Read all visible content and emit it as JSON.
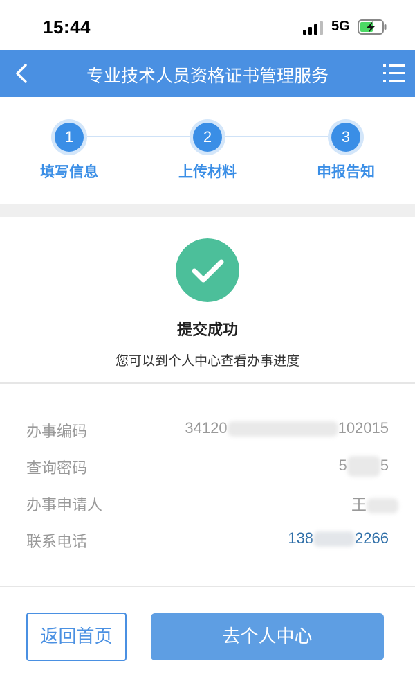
{
  "status_bar": {
    "time": "15:44",
    "network": "5G",
    "battery_color": "#4cd964"
  },
  "navbar": {
    "title": "专业技术人员资格证书管理服务",
    "color": "#4a90e2",
    "back_icon": "chevron-left-icon",
    "menu_icon": "list-menu-icon"
  },
  "steps": [
    {
      "number": "1",
      "label": "填写信息"
    },
    {
      "number": "2",
      "label": "上传材料"
    },
    {
      "number": "3",
      "label": "申报告知"
    }
  ],
  "success": {
    "icon": "check-circle-icon",
    "title": "提交成功",
    "subtitle": "您可以到个人中心查看办事进度"
  },
  "info": {
    "code": {
      "label": "办事编码",
      "value_prefix": "34120",
      "value_suffix": "102015"
    },
    "password": {
      "label": "查询密码",
      "value_prefix": "5",
      "value_suffix": "5"
    },
    "applicant": {
      "label": "办事申请人",
      "value_prefix": "王",
      "value_suffix": ""
    },
    "phone": {
      "label": "联系电话",
      "value_prefix": "138",
      "value_suffix": "2266"
    }
  },
  "buttons": {
    "home": "返回首页",
    "personal_center": "去个人中心"
  }
}
